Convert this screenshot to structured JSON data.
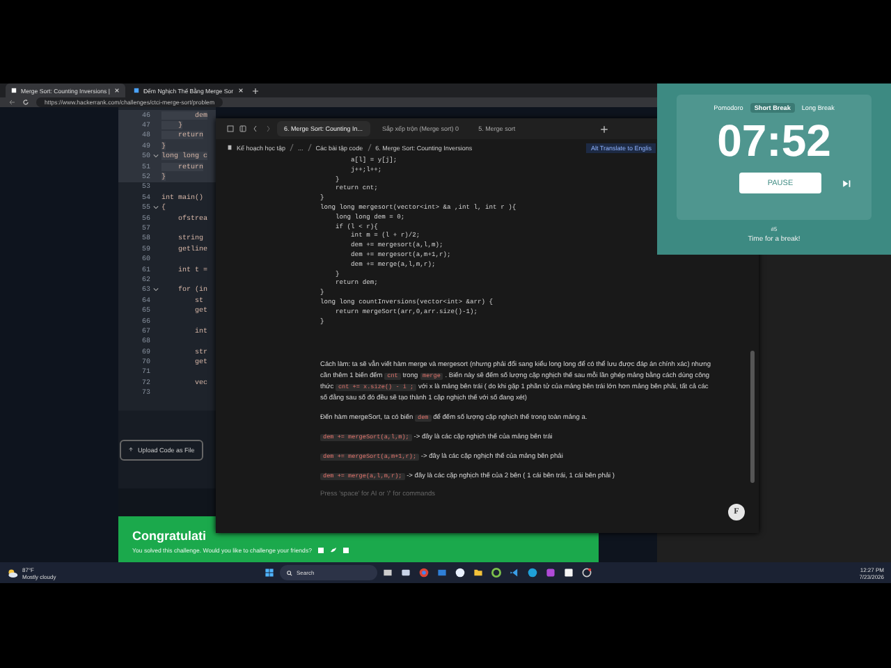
{
  "browser": {
    "tabs": [
      {
        "title": "Merge Sort: Counting Inversions |",
        "selected": true
      },
      {
        "title": "Đếm Nghịch Thế Bằng Merge Sor",
        "selected": false
      }
    ],
    "url": "https://www.hackerrank.com/challenges/ctci-merge-sort/problem",
    "editor_lines": [
      {
        "number": "46",
        "code": "        dem",
        "highlighted": true
      },
      {
        "number": "47",
        "code": "    }",
        "highlighted": true
      },
      {
        "number": "48",
        "code": "    return",
        "highlighted": true
      },
      {
        "number": "49",
        "code": "}",
        "highlighted": true
      },
      {
        "number": "50",
        "code": "long long c",
        "highlighted": true,
        "fold": true
      },
      {
        "number": "51",
        "code": "    return",
        "highlighted": true
      },
      {
        "number": "52",
        "code": "}",
        "highlighted": true
      },
      {
        "number": "53",
        "highlighted": false
      },
      {
        "number": "54",
        "code": "int main()",
        "highlighted": false
      },
      {
        "number": "55",
        "code": "{",
        "highlighted": false,
        "fold": true
      },
      {
        "number": "56",
        "code": "    ofstrea",
        "highlighted": false
      },
      {
        "number": "57",
        "highlighted": false
      },
      {
        "number": "58",
        "code": "    string",
        "highlighted": false
      },
      {
        "number": "59",
        "code": "    getline",
        "highlighted": false
      },
      {
        "number": "60",
        "highlighted": false
      },
      {
        "number": "61",
        "code": "    int t =",
        "highlighted": false
      },
      {
        "number": "62",
        "highlighted": false
      },
      {
        "number": "63",
        "code": "    for (in",
        "highlighted": false,
        "fold": true
      },
      {
        "number": "64",
        "code": "        st",
        "highlighted": false
      },
      {
        "number": "65",
        "code": "        get",
        "highlighted": false
      },
      {
        "number": "66",
        "highlighted": false
      },
      {
        "number": "67",
        "code": "        int",
        "highlighted": false
      },
      {
        "number": "68",
        "highlighted": false
      },
      {
        "number": "69",
        "code": "        str",
        "highlighted": false
      },
      {
        "number": "70",
        "code": "        get",
        "highlighted": false
      },
      {
        "number": "71",
        "highlighted": false
      },
      {
        "number": "72",
        "code": "        vec",
        "highlighted": false
      },
      {
        "number": "73",
        "highlighted": false
      }
    ],
    "upload_button": "Upload Code as File",
    "success": {
      "title": "Congratulati",
      "message": "You solved this challenge. Would you like to challenge your friends?"
    }
  },
  "notes": {
    "tabs": [
      {
        "title": "6. Merge Sort: Counting In...",
        "selected": true
      },
      {
        "title": "Sắp xếp trộn (Merge sort) 0",
        "selected": false
      },
      {
        "title": "5. Merge sort",
        "selected": false
      }
    ],
    "breadcrumb": [
      "Kế hoạch học tập",
      "...",
      "Các bài tập code",
      "6. Merge Sort: Counting Inversions"
    ],
    "translate": "Alt Translate to Englis",
    "code": [
      "        a[l] = y[j];",
      "        j++;l++;",
      "    }",
      "    return cnt;",
      "}",
      "long long mergesort(vector<int> &a ,int l, int r ){",
      "    long long dem = 0;",
      "    if (l < r){",
      "        int m = (l + r)/2;",
      "        dem += mergesort(a,l,m);",
      "        dem += mergesort(a,m+1,r);",
      "        dem += merge(a,l,m,r);",
      "    }",
      "    return dem;",
      "}",
      "long long countInversions(vector<int> &arr) {",
      "    return mergeSort(arr,0,arr.size()-1);",
      "}"
    ],
    "paragraphs": [
      [
        {
          "kind": "text",
          "text": "Cách làm: ta sẽ vẫn viết hàm merge và mergesort (nhưng phải đổi sang kiểu long long để có thể lưu được đáp án chính xác) nhưng cần thêm 1 biến đếm "
        },
        {
          "kind": "code",
          "text": "cnt"
        },
        {
          "kind": "text",
          "text": " trong "
        },
        {
          "kind": "code",
          "text": "merge"
        },
        {
          "kind": "text",
          "text": " . Biến này sẽ đếm số lượng cặp nghịch thế sau mỗi lần ghép mảng bằng cách dùng công thức "
        },
        {
          "kind": "code",
          "text": "cnt += x.size() - i ;"
        },
        {
          "kind": "text",
          "text": " với x là mảng bên trái ( do khi gặp 1 phần tử của mảng bên trái lớn hơn mảng bên phải, tất cả các số đằng sau số đó đều sẽ tạo thành 1 cặp nghịch thế với số đang xét)"
        }
      ],
      [
        {
          "kind": "text",
          "text": "Đến hàm mergeSort, ta có biến "
        },
        {
          "kind": "code",
          "text": "dem"
        },
        {
          "kind": "text",
          "text": " để đếm số lượng cặp nghịch thế trong toàn mảng a."
        }
      ],
      [
        {
          "kind": "code",
          "text": "dem += mergeSort(a,l,m);"
        },
        {
          "kind": "text",
          "text": " -> đây là các cặp nghịch thế của mảng bên trái"
        }
      ],
      [
        {
          "kind": "code",
          "text": "dem += mergeSort(a,m+1,r);"
        },
        {
          "kind": "text",
          "text": " -> đây là các cặp nghịch thế của mảng bên phải"
        }
      ],
      [
        {
          "kind": "code",
          "text": "dem += merge(a,l,m,r);"
        },
        {
          "kind": "text",
          "text": " -> đây là các cặp nghịch thế của 2 bên ( 1 cái bên trái, 1 cái bên phải )"
        }
      ]
    ],
    "placeholder": "Press 'space' for AI or '/' for commands",
    "assistant_button": "F"
  },
  "timer": {
    "modes": [
      {
        "label": "Pomodoro",
        "selected": false
      },
      {
        "label": "Short Break",
        "selected": true
      },
      {
        "label": "Long Break",
        "selected": false
      }
    ],
    "time": "07:52",
    "button": "PAUSE",
    "round": "#5",
    "message": "Time for a break!"
  },
  "taskbar": {
    "weather": {
      "temperature": "87°F",
      "condition": "Mostly cloudy"
    },
    "search": "Search",
    "time": "12:27 PM",
    "date": "7/23/2026"
  }
}
